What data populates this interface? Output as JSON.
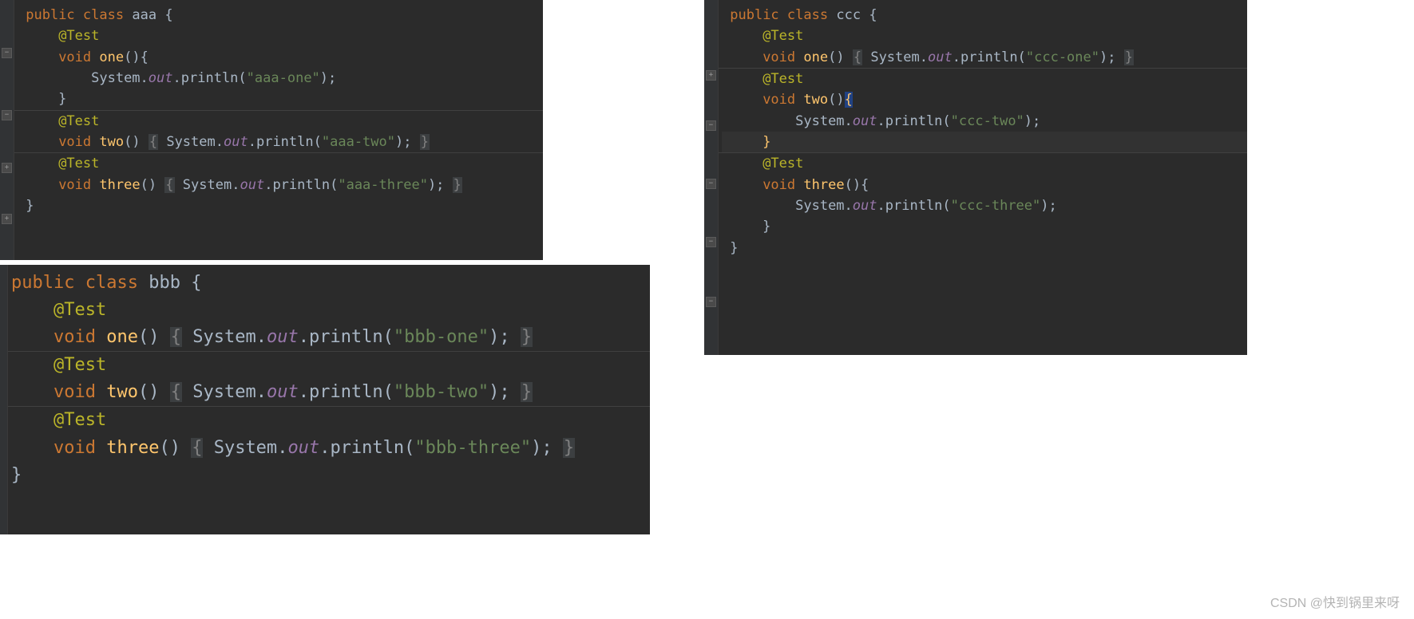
{
  "kw": {
    "public": "public",
    "class": "class",
    "void": "void"
  },
  "anno": "@Test",
  "sys": "System",
  "out": "out",
  "println": "println",
  "aaa": {
    "className": "aaa",
    "m1": "one",
    "m2": "two",
    "m3": "three",
    "s1": "\"aaa-one\"",
    "s2": "\"aaa-two\"",
    "s3": "\"aaa-three\""
  },
  "bbb": {
    "className": "bbb",
    "m1": "one",
    "m2": "two",
    "m3": "three",
    "s1": "\"bbb-one\"",
    "s2": "\"bbb-two\"",
    "s3": "\"bbb-three\""
  },
  "ccc": {
    "className": "ccc",
    "m1": "one",
    "m2": "two",
    "m3": "three",
    "s1": "\"ccc-one\"",
    "s2": "\"ccc-two\"",
    "s3": "\"ccc-three\""
  },
  "foldGlyph": {
    "plus": "+",
    "minus": "−"
  },
  "watermark": "CSDN @快到锅里来呀"
}
